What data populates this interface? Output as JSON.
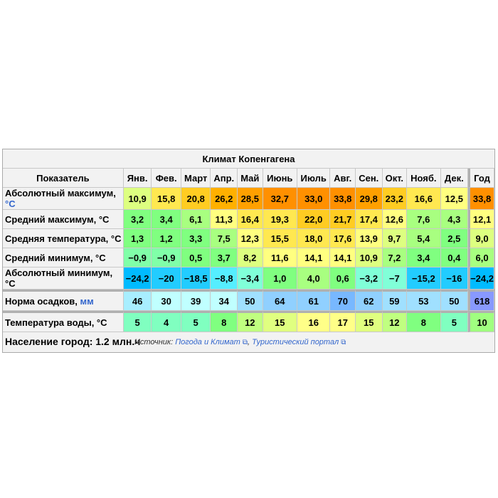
{
  "title": "Климат Копенгагена",
  "header": {
    "label": "Показатель",
    "months": [
      "Янв.",
      "Фев.",
      "Март",
      "Апр.",
      "Май",
      "Июнь",
      "Июль",
      "Авг.",
      "Сен.",
      "Окт.",
      "Нояб.",
      "Дек."
    ],
    "year": "Год"
  },
  "rows": [
    {
      "label": "Абсолютный максимум, ",
      "unit": "°C",
      "values": [
        "10,9",
        "15,8",
        "20,8",
        "26,2",
        "28,5",
        "32,7",
        "33,0",
        "33,8",
        "29,8",
        "23,2",
        "16,6",
        "12,5"
      ],
      "year": "33,8",
      "scale": "temp"
    },
    {
      "label": "Средний максимум, °C",
      "unit": "",
      "values": [
        "3,2",
        "3,4",
        "6,1",
        "11,3",
        "16,4",
        "19,3",
        "22,0",
        "21,7",
        "17,4",
        "12,6",
        "7,6",
        "4,3"
      ],
      "year": "12,1",
      "scale": "temp"
    },
    {
      "label": "Средняя температура, °C",
      "unit": "",
      "values": [
        "1,3",
        "1,2",
        "3,3",
        "7,5",
        "12,3",
        "15,5",
        "18,0",
        "17,6",
        "13,9",
        "9,7",
        "5,4",
        "2,5"
      ],
      "year": "9,0",
      "scale": "temp"
    },
    {
      "label": "Средний минимум, °C",
      "unit": "",
      "values": [
        "−0,9",
        "−0,9",
        "0,5",
        "3,7",
        "8,2",
        "11,6",
        "14,1",
        "14,1",
        "10,9",
        "7,2",
        "3,4",
        "0,4"
      ],
      "year": "6,0",
      "scale": "temp"
    },
    {
      "label": "Абсолютный минимум, °C",
      "unit": "",
      "values": [
        "−24,2",
        "−20",
        "−18,5",
        "−8,8",
        "−3,4",
        "1,0",
        "4,0",
        "0,6",
        "−3,2",
        "−7",
        "−15,2",
        "−16"
      ],
      "year": "−24,2",
      "scale": "temp"
    },
    {
      "label": "Норма осадков, ",
      "unit": "мм",
      "values": [
        "46",
        "30",
        "39",
        "34",
        "50",
        "64",
        "61",
        "70",
        "62",
        "59",
        "53",
        "50"
      ],
      "year": "618",
      "scale": "precip"
    },
    {
      "label": "Температура воды, °C",
      "unit": "",
      "values": [
        "5",
        "4",
        "5",
        "8",
        "12",
        "15",
        "16",
        "17",
        "15",
        "12",
        "8",
        "5"
      ],
      "year": "10",
      "scale": "water"
    }
  ],
  "footer": {
    "population": "Население город: 1.2 млн.ч",
    "source_label": "Источник: ",
    "links": [
      "Погода и Климат",
      "Туристический портал"
    ],
    "separator": ", "
  }
}
